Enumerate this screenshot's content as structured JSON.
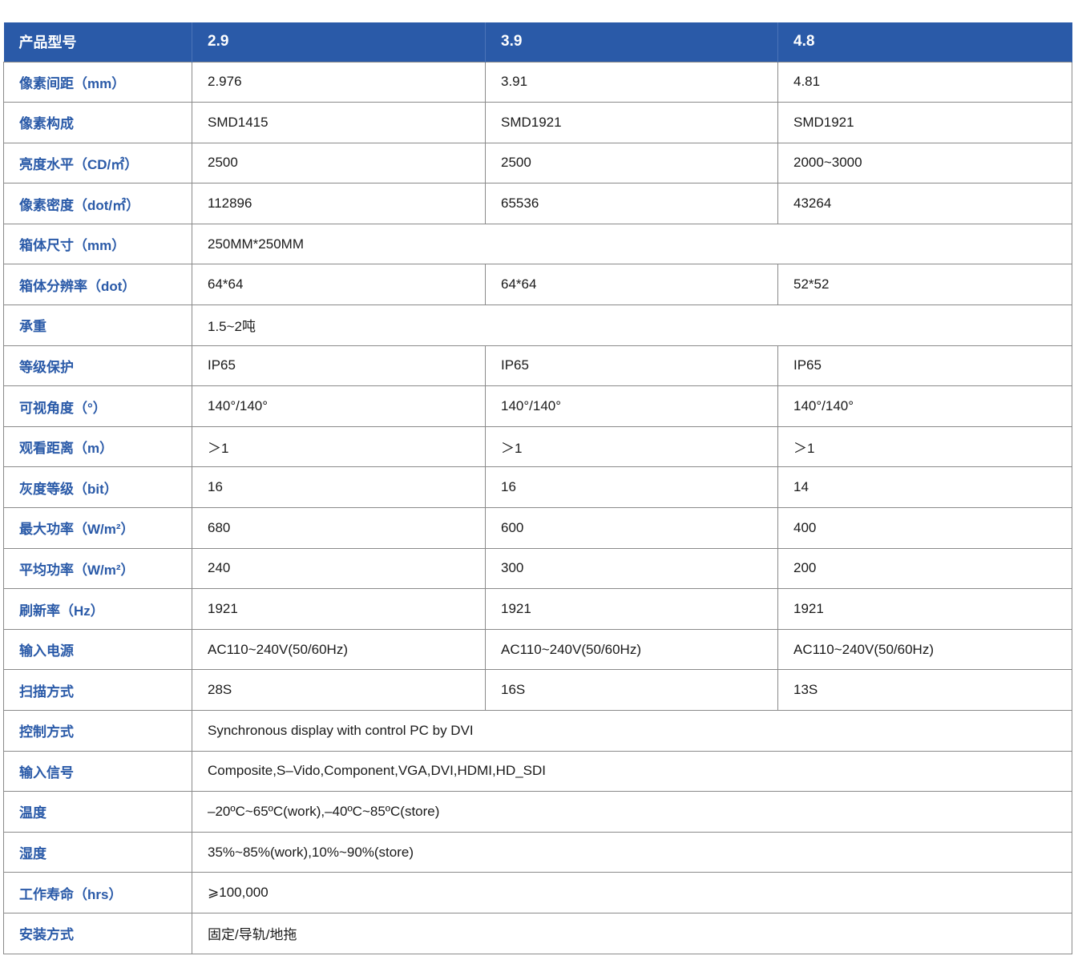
{
  "table": {
    "header": {
      "label": "产品型号",
      "models": [
        "2.9",
        "3.9",
        "4.8"
      ]
    },
    "rows": [
      {
        "label": "像素间距（mm）",
        "values": [
          "2.976",
          "3.91",
          "4.81"
        ]
      },
      {
        "label": "像素构成",
        "values": [
          "SMD1415",
          "SMD1921",
          "SMD1921"
        ]
      },
      {
        "label": "亮度水平（CD/㎡）",
        "values": [
          "2500",
          "2500",
          "2000~3000"
        ]
      },
      {
        "label": "像素密度（dot/㎡）",
        "values": [
          "112896",
          "65536",
          "43264"
        ]
      },
      {
        "label": "箱体尺寸（mm）",
        "values": [
          "250MM*250MM"
        ]
      },
      {
        "label": "箱体分辨率（dot）",
        "values": [
          "64*64",
          "64*64",
          "52*52"
        ]
      },
      {
        "label": "承重",
        "values": [
          "1.5~2吨"
        ]
      },
      {
        "label": "等级保护",
        "values": [
          "IP65",
          "IP65",
          "IP65"
        ]
      },
      {
        "label": "可视角度（°）",
        "values": [
          "140°/140°",
          "140°/140°",
          "140°/140°"
        ]
      },
      {
        "label": "观看距离（m）",
        "values": [
          "＞1",
          "＞1",
          "＞1"
        ]
      },
      {
        "label": "灰度等级（bit）",
        "values": [
          "16",
          "16",
          "14"
        ]
      },
      {
        "label": "最大功率（W/m²）",
        "values": [
          "680",
          "600",
          "400"
        ]
      },
      {
        "label": "平均功率（W/m²）",
        "values": [
          "240",
          "300",
          "200"
        ]
      },
      {
        "label": "刷新率（Hz）",
        "values": [
          "1921",
          "1921",
          "1921"
        ]
      },
      {
        "label": "输入电源",
        "values": [
          "AC110~240V(50/60Hz)",
          "AC110~240V(50/60Hz)",
          "AC110~240V(50/60Hz)"
        ]
      },
      {
        "label": "扫描方式",
        "values": [
          "28S",
          "16S",
          "13S"
        ]
      },
      {
        "label": "控制方式",
        "values": [
          "Synchronous display with control PC by DVI"
        ]
      },
      {
        "label": "输入信号",
        "values": [
          "Composite,S–Vido,Component,VGA,DVI,HDMI,HD_SDI"
        ]
      },
      {
        "label": "温度",
        "values": [
          "–20ºC~65ºC(work),–40ºC~85ºC(store)"
        ]
      },
      {
        "label": "湿度",
        "values": [
          "35%~85%(work),10%~90%(store)"
        ]
      },
      {
        "label": "工作寿命（hrs）",
        "values": [
          "⩾100,000"
        ]
      },
      {
        "label": "安装方式",
        "values": [
          "固定/导轨/地拖"
        ]
      }
    ]
  }
}
